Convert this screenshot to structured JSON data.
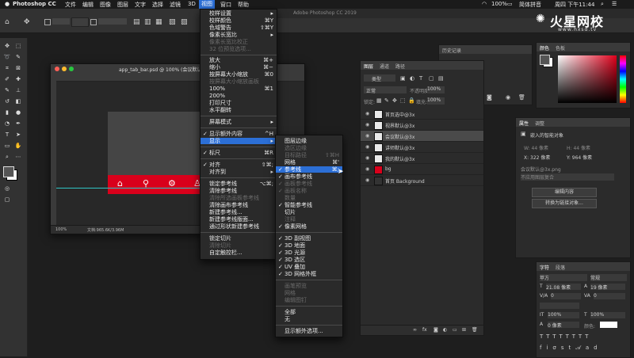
{
  "menubar": {
    "apple": "",
    "items": [
      "Photoshop CC",
      "文件",
      "编辑",
      "图像",
      "图层",
      "文字",
      "选择",
      "滤镜",
      "3D",
      "视图",
      "窗口",
      "帮助"
    ],
    "active_index": 9,
    "status_battery": "100%",
    "status_input": "简体拼音",
    "status_time": "周四 下午11:44"
  },
  "app_title": "Adobe Photoshop CC 2019",
  "watermark": {
    "brand": "火星网校",
    "url": "www.hxsd.tv"
  },
  "document": {
    "title": "app_tab_bar.psd @ 100% (会议默认...)",
    "zoom": "100%",
    "file_info": "文档:965.6K/3.96M"
  },
  "view_menu": {
    "items": [
      {
        "label": "校样设置",
        "shortcut": "▸",
        "state": "normal"
      },
      {
        "label": "校样颜色",
        "shortcut": "⌘Y",
        "state": "normal"
      },
      {
        "label": "色域警告",
        "shortcut": "⇧⌘Y",
        "state": "normal"
      },
      {
        "label": "像素长宽比",
        "shortcut": "▸",
        "state": "normal"
      },
      {
        "label": "像素长宽比校正",
        "shortcut": "",
        "state": "disabled"
      },
      {
        "label": "32 位预览选项...",
        "shortcut": "",
        "state": "disabled"
      },
      {
        "label": "放大",
        "shortcut": "⌘+",
        "state": "normal"
      },
      {
        "label": "缩小",
        "shortcut": "⌘−",
        "state": "normal"
      },
      {
        "label": "按屏幕大小缩放",
        "shortcut": "⌘0",
        "state": "normal"
      },
      {
        "label": "按屏幕大小缩放画板",
        "shortcut": "",
        "state": "disabled"
      },
      {
        "label": "100%",
        "shortcut": "⌘1",
        "state": "normal"
      },
      {
        "label": "200%",
        "shortcut": "",
        "state": "normal"
      },
      {
        "label": "打印尺寸",
        "shortcut": "",
        "state": "normal"
      },
      {
        "label": "水平翻转",
        "shortcut": "",
        "state": "normal"
      },
      {
        "label": "屏幕模式",
        "shortcut": "▸",
        "state": "normal"
      },
      {
        "label": "显示额外内容",
        "shortcut": "^H",
        "state": "checked"
      },
      {
        "label": "显示",
        "shortcut": "▸",
        "state": "highlight"
      },
      {
        "label": "标尺",
        "shortcut": "⌘R",
        "state": "checked"
      },
      {
        "label": "对齐",
        "shortcut": "⇧⌘;",
        "state": "checked"
      },
      {
        "label": "对齐到",
        "shortcut": "▸",
        "state": "normal"
      },
      {
        "label": "锁定参考线",
        "shortcut": "⌥⌘;",
        "state": "normal"
      },
      {
        "label": "清除参考线",
        "shortcut": "",
        "state": "normal"
      },
      {
        "label": "清除所选画板参考线",
        "shortcut": "",
        "state": "disabled"
      },
      {
        "label": "清除画布参考线",
        "shortcut": "",
        "state": "normal"
      },
      {
        "label": "新建参考线...",
        "shortcut": "",
        "state": "normal"
      },
      {
        "label": "新建参考线版面...",
        "shortcut": "",
        "state": "normal"
      },
      {
        "label": "通过形状新建参考线",
        "shortcut": "",
        "state": "normal"
      },
      {
        "label": "锁定切片",
        "shortcut": "",
        "state": "normal"
      },
      {
        "label": "清除切片",
        "shortcut": "",
        "state": "disabled"
      },
      {
        "label": "自定触控栏...",
        "shortcut": "",
        "state": "normal"
      }
    ]
  },
  "show_submenu": {
    "items": [
      {
        "label": "图层边缘",
        "shortcut": "",
        "state": "normal"
      },
      {
        "label": "选区边缘",
        "shortcut": "",
        "state": "disabled"
      },
      {
        "label": "目标路径",
        "shortcut": "⇧⌘H",
        "state": "disabled"
      },
      {
        "label": "网格",
        "shortcut": "⌘'",
        "state": "normal"
      },
      {
        "label": "参考线",
        "shortcut": "⌘;",
        "state": "highlight"
      },
      {
        "label": "画布参考线",
        "shortcut": "",
        "state": "checked"
      },
      {
        "label": "画板参考线",
        "shortcut": "",
        "state": "checked-dis"
      },
      {
        "label": "画板名称",
        "shortcut": "",
        "state": "checked-dis"
      },
      {
        "label": "数量",
        "shortcut": "",
        "state": "disabled"
      },
      {
        "label": "智能参考线",
        "shortcut": "",
        "state": "checked"
      },
      {
        "label": "切片",
        "shortcut": "",
        "state": "normal"
      },
      {
        "label": "注释",
        "shortcut": "",
        "state": "disabled"
      },
      {
        "label": "像素网格",
        "shortcut": "",
        "state": "checked"
      },
      {
        "label": "3D 副视图",
        "shortcut": "",
        "state": "checked"
      },
      {
        "label": "3D 地面",
        "shortcut": "",
        "state": "checked"
      },
      {
        "label": "3D 光源",
        "shortcut": "",
        "state": "checked"
      },
      {
        "label": "3D 选区",
        "shortcut": "",
        "state": "checked"
      },
      {
        "label": "UV 叠加",
        "shortcut": "",
        "state": "checked"
      },
      {
        "label": "3D 网格外框",
        "shortcut": "",
        "state": "checked"
      },
      {
        "label": "画笔预览",
        "shortcut": "",
        "state": "disabled"
      },
      {
        "label": "网格",
        "shortcut": "",
        "state": "disabled"
      },
      {
        "label": "编辑图钉",
        "shortcut": "",
        "state": "disabled"
      },
      {
        "label": "全部",
        "shortcut": "",
        "state": "normal"
      },
      {
        "label": "无",
        "shortcut": "",
        "state": "normal"
      },
      {
        "label": "显示额外选项...",
        "shortcut": "",
        "state": "normal"
      }
    ]
  },
  "history_panel": {
    "tab": "历史记录"
  },
  "layers_panel": {
    "tabs": [
      "图层",
      "通道",
      "路径"
    ],
    "filter": "类型",
    "blend": "正常",
    "opacity_label": "不透明度:",
    "opacity": "100%",
    "lock_label": "锁定:",
    "fill_label": "填充:",
    "fill": "100%",
    "layers": [
      "首页选中@3x",
      "视界默认@3x",
      "会议默认@3x",
      "讲师默认@3x",
      "我的默认@3x",
      "bg",
      "首页 Background"
    ]
  },
  "color_panel": {
    "tabs": [
      "颜色",
      "色板"
    ]
  },
  "properties_panel": {
    "tabs": [
      "属性",
      "调整"
    ],
    "type": "嵌入的智能对象",
    "w": "W: 44 像素",
    "h": "H: 44 像素",
    "x": "X: 322 像素",
    "y": "Y: 964 像素",
    "filename": "会议默认@3x.png",
    "layer_comp": "不应用图层复合",
    "btn_edit": "编辑内容",
    "btn_convert": "转换为链接对象..."
  },
  "char_panel": {
    "tabs": [
      "字符",
      "段落"
    ],
    "font": "苹方",
    "style": "常规",
    "size": "21.08 像素",
    "leading": "19 像素",
    "kerning": "0",
    "tracking": "0",
    "scale_v": "100%",
    "scale_h": "100%",
    "baseline": "0 像素",
    "color_label": "颜色:"
  },
  "colors": {
    "accent": "#2c6fd6",
    "tab_red": "#d9001b",
    "guide": "#2fc6c6"
  }
}
